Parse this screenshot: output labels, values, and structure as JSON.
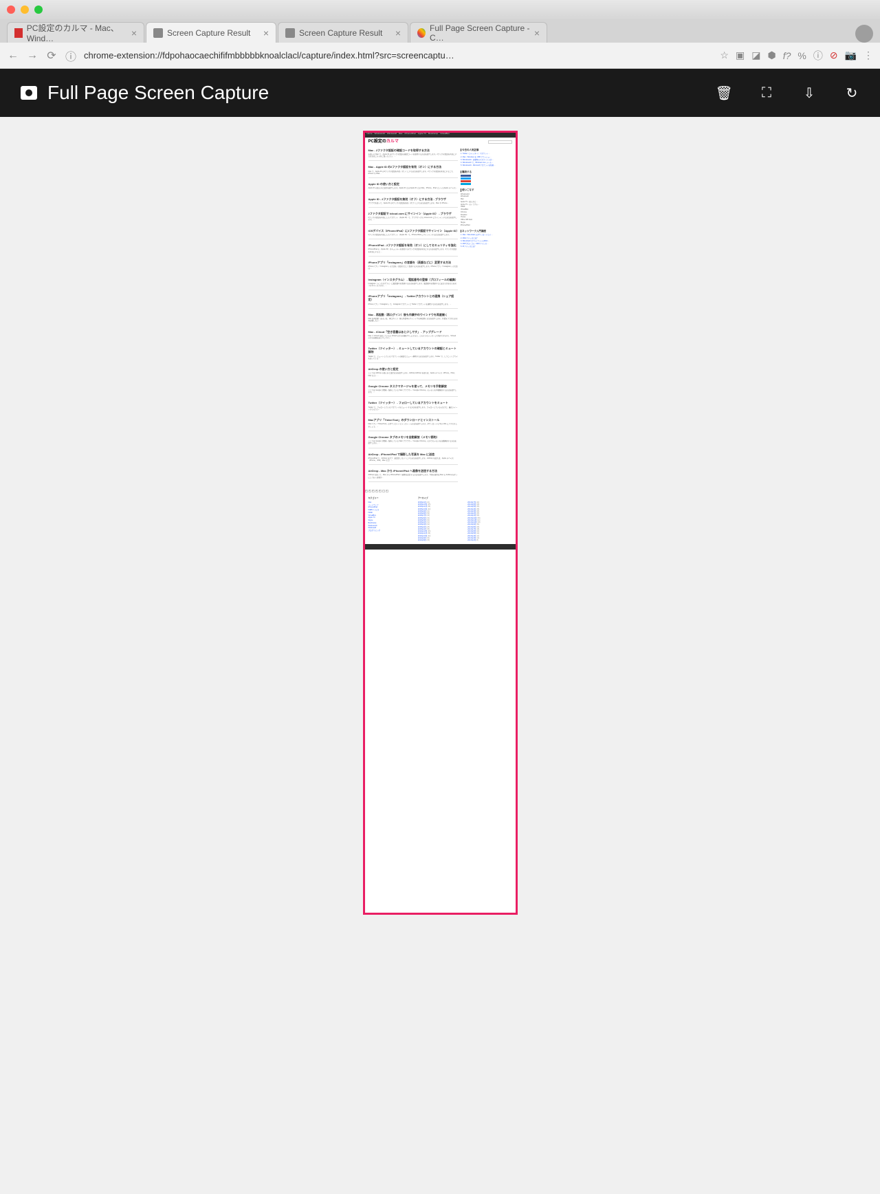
{
  "browser": {
    "tabs": [
      {
        "title": "PC設定のカルマ - Mac、Wind…",
        "active": false,
        "favicon": "red"
      },
      {
        "title": "Screen Capture Result",
        "active": true,
        "favicon": "cam"
      },
      {
        "title": "Screen Capture Result",
        "active": false,
        "favicon": "cam"
      },
      {
        "title": "Full Page Screen Capture - C…",
        "active": false,
        "favicon": "multi"
      }
    ],
    "url": "chrome-extension://fdpohaocaechififmbbbbbknoalclacl/capture/index.html?src=screencaptu…"
  },
  "extension": {
    "title": "Full Page Screen Capture",
    "actions": [
      "delete",
      "expand",
      "download",
      "history"
    ]
  },
  "captured_page": {
    "nav": [
      "Home",
      "Windows10",
      "Windows8",
      "Mac",
      "iPhone/iPad",
      "Apple TV",
      "BootCamp",
      "VirtualBox"
    ],
    "logo_main": "PC設定の",
    "logo_accent": "カルマ",
    "articles": [
      {
        "title": "Mac - 2ファクタ認証の確認コードを取得する方法",
        "body": "お使いの Mac で、Apple ID の2ファクタ認証の確認コードを取得する方法を紹介します。2ファクタ認証を有効にする方法はこちらをご覧ください。…"
      },
      {
        "title": "Mac - Apple ID の2ファクタ認証を有効（オン）にする方法",
        "body": "Mac で、Apple ID の2ファクタ認証を有効（オン）にする方法を紹介します。2ファクタ認証を有効にするこで、iPhone や iPad…"
      },
      {
        "title": "Apple ID の使い方と設定",
        "body": "Apple ID の使い方と設定を紹介します。Apple ID とは Apple ID とは Mac、iPhone、iPad といったApple デバイス…"
      },
      {
        "title": "Apple ID - 2ファクタ認証を無効（オフ）にする方法 - ブラウザ",
        "body": "ブラウザを使って、Apple ID の2ファクタ認証を無効（オフ）にする方法を紹介します。Mac や iPhone…"
      },
      {
        "title": "2ファクタ認証で icloud.com にサインイン（Apple ID） - ブラウザ",
        "body": "2ファクタ認証を有効にしたアカウント（Apple ID）で、ブラウザーから icloud.com にサインインする方法を紹介します。…"
      },
      {
        "title": "iOSデバイス（iPhone/iPad）に2ファクタ認証でサインイン（Apple ID）",
        "body": "2ファクタ認証を有効にしたアカウント（Apple ID）で、iPhone/iPad にサインインする方法を紹介します。…"
      },
      {
        "title": "iPhone/iPad - 2ファクタ認証を有効（オン）にしてセキュリティを強化",
        "body": "iPhone/iPad の（Apple ID）セキュリティを強化する2ファクタ認証を有効にする方法を紹介します。2ファクタ認証を有効にすると…"
      },
      {
        "title": "iPhoneアプリ「Instagram」の言語を（英語などに）変更する方法",
        "body": "iPhoneアプリ「Instagram」の言語を（英語などに）変更する方法を紹介します。iPhoneアプリ「Instagram」の言語は…"
      },
      {
        "title": "Instagram（インスタグラム） - 電話番号の登録（プロフィールの編集）",
        "body": "Instagram（インスタグラム）に電話番号を登録する方法を紹介します。電話番号を登録すると友だちがあなたを見つけやすくなります。…"
      },
      {
        "title": "iPhoneアプリ「Instagram」 - Twitterアカウントとの連携（シェア設定）",
        "body": "iPhoneアプリ「Instagram」で、Instagramアカウントと Twitter アカウントを連携する方法を紹介します。…"
      },
      {
        "title": "Mac - 再起動（再ログイン）後も作業中のウインドウを再度開く",
        "body": "Mac を再起動（あるいは、再ログイン）後も作業中のウインドウを再度開く方法を紹介します。作業をつづけたまま再起動したい…"
      },
      {
        "title": "Mac - iCloud「空き容量はあと少しです」 - アップグレード",
        "body": "Mac で iCloud を使っていると iCloud の空き容量が少しになると、このようなメッセージが表示されます。「iCloud の空き容量はあと少しです」…"
      },
      {
        "title": "Twitter（ツイッター） - ミュートしているアカウントの確認とミュート解除",
        "body": "Twitter で、ミュートしているアカウントの確認とミュート解除する方法を紹介します。Twitter で、しつこくリプライを送ってくる…"
      },
      {
        "title": "AirDrop の使い方と設定",
        "body": "ここでは AirDrop の使い方と設定方法を紹介します。AirDrop AirDrop を使えば、Apple デバイス（iPhone、iPad、Mac など）…"
      },
      {
        "title": "Google Chrome タスクマネージャを使って、メモリを手動解放",
        "body": "ここでは Google が開発・配布している Web ブラウザー「Google Chrome」のメモリを手動解放する方法を紹介します。…"
      },
      {
        "title": "Twitter（ツイッター） - フォローしているアカウントをミュート",
        "body": "Twitter で、フォローしているアカウントをミュートする方法を紹介します。フォローしているんだけど、最近ツイートがうるさい…"
      },
      {
        "title": "Macアプリ「TinkerTool」のダウンロードとインストール",
        "body": "Macアプリ「TinkerTool」のダウンロードとインストール方法を紹介します。ダウンロード以下の URL にアクセスしましょう。…"
      },
      {
        "title": "Google Chrome タブのメモリを自動解放（メモリ節約）",
        "body": "ここでは Google が開発・配布している Web ブラウザー「Google Chrome」のタブのメモリを自動解放する方法を紹介します。…"
      },
      {
        "title": "AirDrop - iPhone/iPad で撮影した写真を Mac に送信",
        "body": "iPhone/iPad で、AirDrop をオフ（送受信しない）にする方法を紹介します。AirDrop を使えば、Apple デバイス（iPhone、iPad、Mac など）…"
      },
      {
        "title": "AirDrop - Mac から iPhone/iPad へ画像を送信する方法",
        "body": "AirDrop を使って、Mac から iPhone/iPad へ画像を送信する方法を紹介します。今回の操作は Mac の AirDrop をオンにしておく必要が…"
      }
    ],
    "sidebar": {
      "recent_title": "今日の人気記事",
      "recent": [
        "1. Twitter（ツイッター）アカウント…",
        "2. Mac - Windows を USB フラッシュ…",
        "3. Windows10 - 起動時のパスワード入力…",
        "4. Windows10 で、Windows Live メール…",
        "5. Windows10 - Microsoftアカウントを新規…"
      ],
      "social_title": "購読する",
      "social": [
        "Twitter",
        "Facebook",
        "Google+",
        "はてな",
        "RSS"
      ],
      "cat_title": "使いこなす",
      "categories": [
        "Windows10",
        "Windows8",
        "Mac",
        "Apple TV - 使い方と…",
        "Apple TV - のトラブル…",
        "HDMI",
        "VirtualBox",
        "Chrome",
        "Dropbox",
        "iTunes",
        "Office 365 Solo",
        "Skype",
        "iPhone/iPad"
      ],
      "net_title": "ネットワーク入門講座",
      "net": [
        "1. Mac - Wireshark のダウンロードとイ…",
        "2. MACアドレスとは？",
        "3. WiresharkでクライアントのMAC…",
        "4. ARPプロトコル - MACアドレス…",
        "5. IPアドレスとは？"
      ]
    },
    "footer": {
      "cat_title": "カテゴリー",
      "cats": [
        "Mac",
        "ハードウェア",
        "iPhone/iPad",
        "WEBサービス",
        "HDMI",
        "VirtualBox",
        "Apple TV",
        "Skype",
        "BootCamp",
        "Windows10",
        "Windows8",
        "プログラミング"
      ],
      "archive_title": "アーカイブ",
      "archives": [
        {
          "m": "2016年1月",
          "c": "(22)"
        },
        {
          "m": "2015年12月",
          "c": "(35)"
        },
        {
          "m": "2015年11月",
          "c": "(36)"
        },
        {
          "m": "2015年10月",
          "c": "(42)"
        },
        {
          "m": "2015年9月",
          "c": "(41)"
        },
        {
          "m": "2015年8月",
          "c": "(58)"
        },
        {
          "m": "2015年7月",
          "c": "(45)"
        },
        {
          "m": "2015年6月",
          "c": "(32)"
        },
        {
          "m": "2015年5月",
          "c": "(30)"
        },
        {
          "m": "2015年4月",
          "c": "(31)"
        },
        {
          "m": "2015年3月",
          "c": "(32)"
        },
        {
          "m": "2015年2月",
          "c": "(28)"
        },
        {
          "m": "2015年1月",
          "c": "(35)"
        },
        {
          "m": "2014年12月",
          "c": "(30)"
        },
        {
          "m": "2014年11月",
          "c": "(36)"
        },
        {
          "m": "2014年10月",
          "c": "(42)"
        },
        {
          "m": "2014年9月",
          "c": "(30)"
        },
        {
          "m": "2014年8月",
          "c": "(35)"
        },
        {
          "m": "2014年7月",
          "c": "(42)"
        },
        {
          "m": "2014年6月",
          "c": "(28)"
        },
        {
          "m": "2014年5月",
          "c": "(35)"
        },
        {
          "m": "2014年4月",
          "c": "(38)"
        },
        {
          "m": "2014年3月",
          "c": "(45)"
        },
        {
          "m": "2014年2月",
          "c": "(35)"
        },
        {
          "m": "2014年1月",
          "c": "(56)"
        },
        {
          "m": "2013年12月",
          "c": "(58)"
        },
        {
          "m": "2013年11月",
          "c": "(42)"
        },
        {
          "m": "2013年10月",
          "c": "(38)"
        },
        {
          "m": "2013年9月",
          "c": "(30)"
        },
        {
          "m": "2013年8月",
          "c": "(28)"
        },
        {
          "m": "2013年7月",
          "c": "(18)"
        },
        {
          "m": "2013年6月",
          "c": "(20)"
        },
        {
          "m": "2013年5月",
          "c": "(14)"
        },
        {
          "m": "2013年4月",
          "c": "(12)"
        },
        {
          "m": "2013年3月",
          "c": "(10)"
        },
        {
          "m": "2013年2月",
          "c": "(8)"
        }
      ]
    }
  }
}
